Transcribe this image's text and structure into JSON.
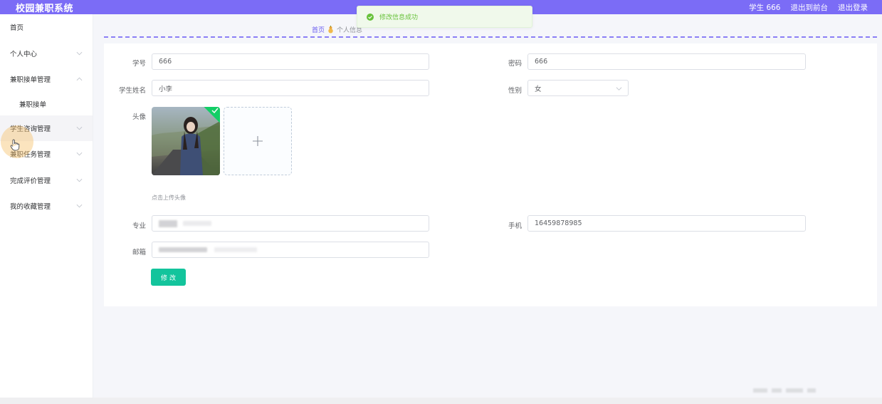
{
  "header": {
    "app_title": "校园兼职系统",
    "user_label": "学生 666",
    "goto_front_label": "退出到前台",
    "logout_label": "退出登录",
    "bg_color": "#7b6cf6"
  },
  "toast": {
    "message": "修改信息成功",
    "icon": "success-check-icon",
    "color": "#67c23a"
  },
  "breadcrumb": {
    "home": "首页",
    "current": "个人信息"
  },
  "sidebar": {
    "items": [
      {
        "label": "首页"
      },
      {
        "label": "个人中心"
      },
      {
        "label": "兼职接单管理"
      },
      {
        "label": "兼职接单"
      },
      {
        "label": "学生咨询管理"
      },
      {
        "label": "兼职任务管理"
      },
      {
        "label": "完成评价管理"
      },
      {
        "label": "我的收藏管理"
      }
    ]
  },
  "form": {
    "student_no_label": "学号",
    "student_no_value": "666",
    "password_label": "密码",
    "password_value": "666",
    "name_label": "学生姓名",
    "name_value": "小李",
    "gender_label": "性别",
    "gender_value": "女",
    "avatar_label": "头像",
    "upload_hint": "点击上传头像",
    "major_label": "专业",
    "phone_label": "手机",
    "phone_value": "16459878985",
    "email_label": "邮箱",
    "submit_label": "修改",
    "submit_color": "#13c49c"
  }
}
